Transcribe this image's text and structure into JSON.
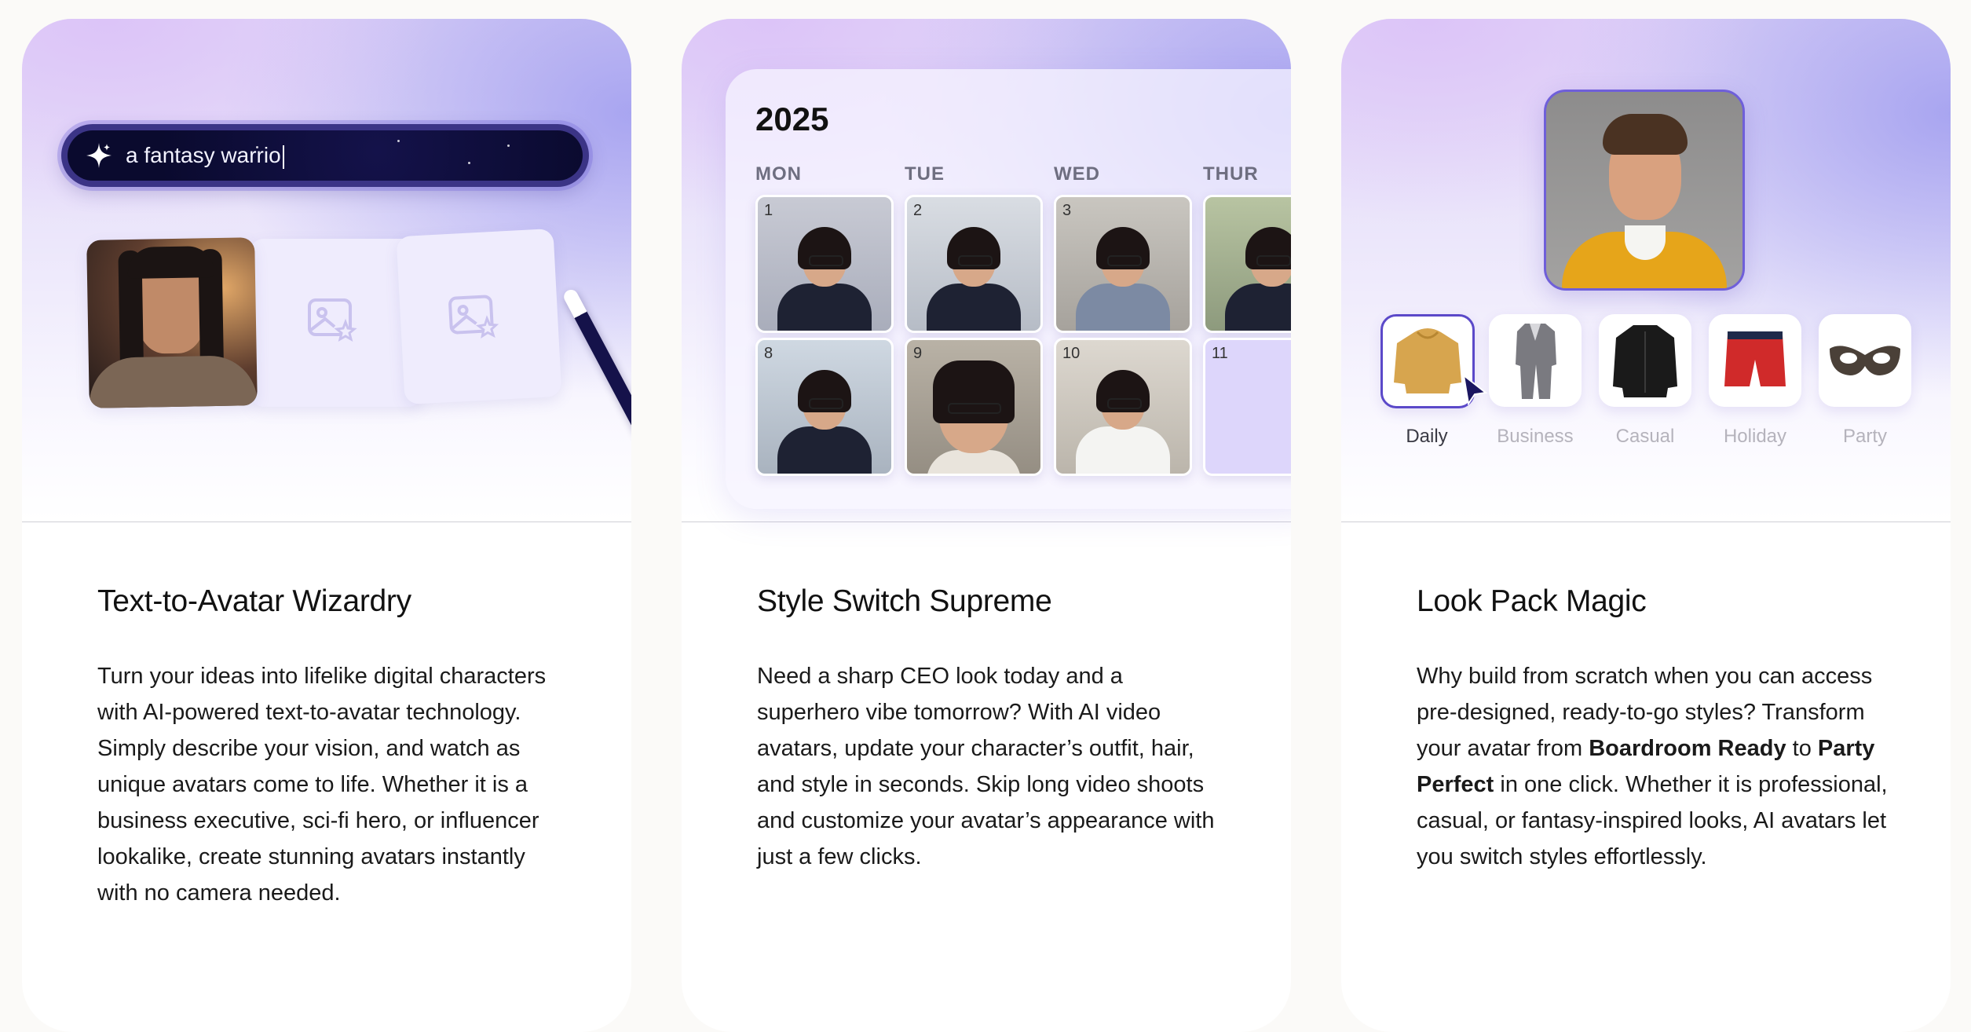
{
  "cards": [
    {
      "title": "Text-to-Avatar Wizardry",
      "prompt_text": "a fantasy warrio",
      "description": "Turn your ideas into lifelike digital characters with AI-powered text-to-avatar technology. Simply describe your vision, and watch as unique avatars come to life. Whether it is a business executive, sci-fi hero, or influencer lookalike, create stunning avatars instantly with no camera needed."
    },
    {
      "title": "Style Switch Supreme",
      "calendar": {
        "year": "2025",
        "days": [
          "MON",
          "TUE",
          "WED",
          "THUR"
        ],
        "dates": [
          "1",
          "2",
          "3",
          "",
          "8",
          "9",
          "10",
          "11"
        ]
      },
      "description": "Need a sharp CEO look today and a superhero vibe tomorrow? With AI video avatars, update your character’s outfit, hair, and style in seconds. Skip long video shoots and customize your avatar’s appearance with just a few clicks."
    },
    {
      "title": "Look Pack Magic",
      "outfits": [
        {
          "label": "Daily",
          "selected": true,
          "color": "#d7a54e"
        },
        {
          "label": "Business",
          "selected": false,
          "color": "#7a7a80"
        },
        {
          "label": "Casual",
          "selected": false,
          "color": "#1a1a1a"
        },
        {
          "label": "Holiday",
          "selected": false,
          "color": "#d02a2a"
        },
        {
          "label": "Party",
          "selected": false,
          "color": "#4a4038"
        }
      ],
      "description_parts": {
        "p1": "Why build from scratch when you can access pre-designed, ready-to-go styles? Transform your avatar from ",
        "b1": "Boardroom Ready",
        "p2": " to ",
        "b2": "Party Perfect",
        "p3": " in one click. Whether it is professional, casual, or fantasy-inspired looks, AI avatars let you switch styles effortlessly."
      }
    }
  ],
  "colors": {
    "accent": "#5b49c9",
    "prompt_bg": "#0a0a2e",
    "page_bg": "#fbfaf8"
  }
}
